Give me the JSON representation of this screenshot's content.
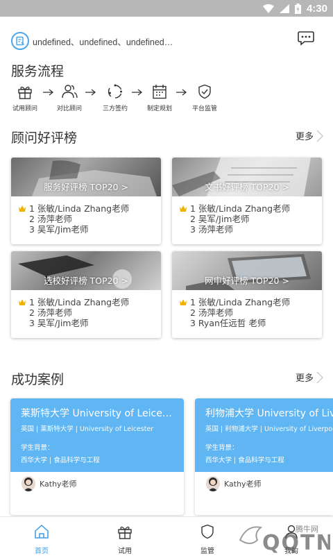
{
  "status_bar": {
    "time": "4:30",
    "icons": [
      "wifi-icon",
      "signal-icon",
      "battery-icon"
    ]
  },
  "header": {
    "topic_text": "undefined、undefined、undefined、undefined",
    "chat_icon": "chat-bubble-icon"
  },
  "service_flow": {
    "title": "服务流程",
    "steps": [
      {
        "label": "试用顾问",
        "icon": "gift-icon"
      },
      {
        "label": "对比顾问",
        "icon": "users-icon"
      },
      {
        "label": "三方签约",
        "icon": "cycle-icon"
      },
      {
        "label": "制定规划",
        "icon": "calendar-icon"
      },
      {
        "label": "平台监管",
        "icon": "shield-icon"
      }
    ]
  },
  "rankings": {
    "title": "顾问好评榜",
    "more": "更多",
    "cards": [
      {
        "banner": "服务好评榜 TOP20 >",
        "items": [
          "1 张敏/Linda Zhang老师",
          "2 汤萍老师",
          "3 吴军/Jim老师"
        ]
      },
      {
        "banner": "文书好评榜 TOP20 >",
        "items": [
          "1 张敏/Linda Zhang老师",
          "2 吴军/Jim老师",
          "3 汤萍老师"
        ]
      },
      {
        "banner": "选校好评榜 TOP20 >",
        "items": [
          "1 张敏/Linda Zhang老师",
          "2 汤萍老师",
          "3 吴军/Jim老师"
        ]
      },
      {
        "banner": "网申好评榜 TOP20 >",
        "items": [
          "1 张敏/Linda Zhang老师",
          "2 汤萍老师",
          "3 Ryan任远哲 老师"
        ]
      }
    ]
  },
  "cases": {
    "title": "成功案例",
    "more": "更多",
    "cards": [
      {
        "university": "莱斯特大学 University of Leicester",
        "subtitle": "英国 | 莱斯特大学 | University of Leicester",
        "bg_label": "学生背景：",
        "bg_value": "西华大学 | 食品科学与工程",
        "teacher": "Kathy老师"
      },
      {
        "university": "利物浦大学 University of Liverpool",
        "subtitle": "英国 | 利物浦大学 | University of Liverpool",
        "bg_label": "学生背景：",
        "bg_value": "西华大学 | 食品科学与工程",
        "teacher": "Kathy老师"
      }
    ]
  },
  "tabbar": {
    "tabs": [
      {
        "label": "首页",
        "icon": "home-icon",
        "active": true
      },
      {
        "label": "试用",
        "icon": "gift-icon",
        "active": false
      },
      {
        "label": "监管",
        "icon": "shield-icon",
        "active": false
      },
      {
        "label": "我的",
        "icon": "user-icon",
        "active": false
      }
    ]
  },
  "watermark": {
    "text": "QQTN",
    "sub": "腾牛网"
  },
  "colors": {
    "accent": "#3b9ce8",
    "case_head": "#60b6f2",
    "crown": "#f0b400"
  }
}
